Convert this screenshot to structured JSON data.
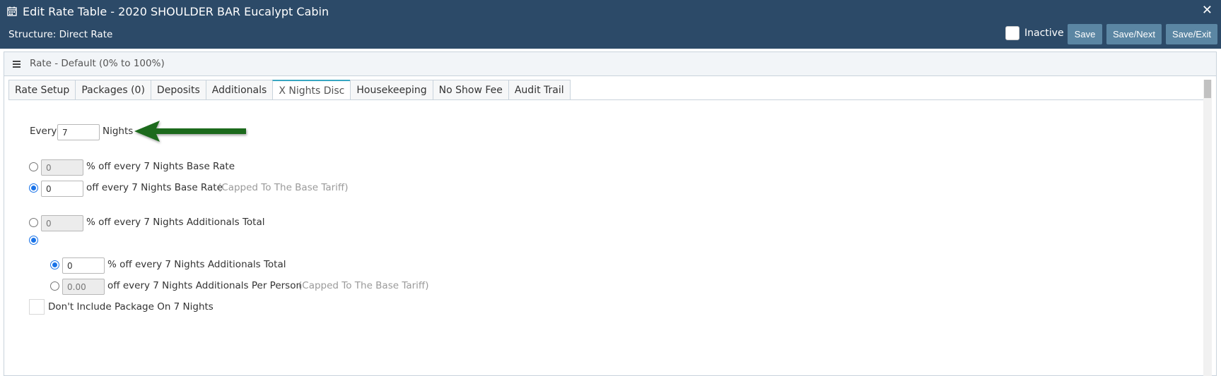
{
  "header": {
    "title": "Edit Rate Table - 2020 SHOULDER BAR Eucalypt Cabin",
    "structure": "Structure: Direct Rate",
    "inactive_label": "Inactive",
    "save_label": "Save",
    "save_next_label": "Save/Next",
    "save_exit_label": "Save/Exit",
    "close_glyph": "✕"
  },
  "panel": {
    "title": "Rate - Default (0% to 100%)"
  },
  "tabs": [
    {
      "label": "Rate Setup"
    },
    {
      "label": "Packages (0)"
    },
    {
      "label": "Deposits"
    },
    {
      "label": "Additionals"
    },
    {
      "label": "X Nights Disc",
      "active": true
    },
    {
      "label": "Housekeeping"
    },
    {
      "label": "No Show Fee"
    },
    {
      "label": "Audit Trail"
    }
  ],
  "form": {
    "every_label": "Every",
    "nights_value": "7",
    "nights_label": "Nights",
    "base_pct_value": "0",
    "base_pct_label": "% off every 7 Nights Base Rate",
    "base_amt_value": "0",
    "base_amt_label": "off every 7 Nights Base Rate",
    "base_amt_note": "(Capped To The Base Tariff)",
    "add_pct_value": "0",
    "add_pct_label": "% off every 7 Nights Additionals Total",
    "sub_pct_value": "0",
    "sub_pct_label": "% off every 7 Nights Additionals Total",
    "sub_pp_value": "0.00",
    "sub_pp_label": "off every 7 Nights Additionals Per Person",
    "sub_pp_note": "(Capped To The Base Tariff)",
    "package_label": "Don't Include Package On 7 Nights"
  },
  "colors": {
    "header_bg": "#2c4a68",
    "button_bg": "#5b86a3",
    "active_tab_accent": "#39a6c2",
    "radio_checked": "#1a73e8",
    "arrow": "#1e6b1e"
  },
  "icons": [
    "calendar-icon",
    "close-icon",
    "hamburger-icon",
    "arrow-left-icon"
  ]
}
